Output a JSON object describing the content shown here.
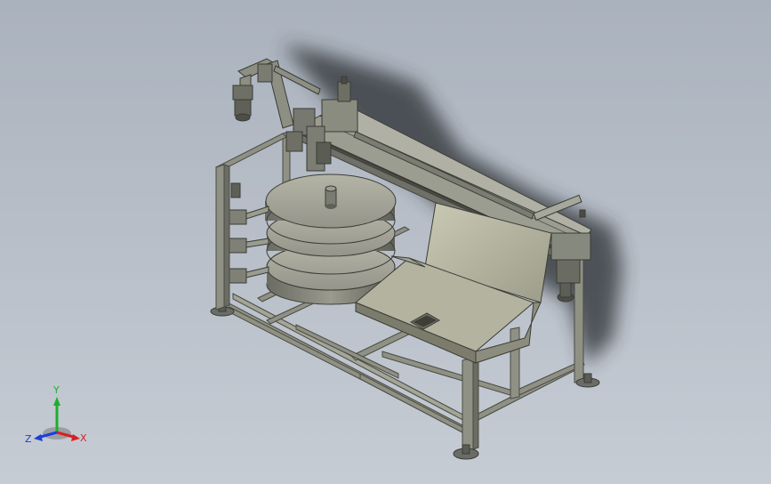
{
  "viewport": {
    "background_top": "#aab2bd",
    "background_bottom": "#c6ccd4"
  },
  "model": {
    "frame_color": "#8f9184",
    "frame_dark": "#4a4b44",
    "disc_color": "#a7a799",
    "chute_color": "#b9b9a6",
    "shadow_color": "#2b2e33"
  },
  "triad": {
    "x_label": "X",
    "y_label": "Y",
    "z_label": "Z",
    "x_color": "#d92020",
    "y_color": "#1fae2a",
    "z_color": "#1d3fd8"
  }
}
